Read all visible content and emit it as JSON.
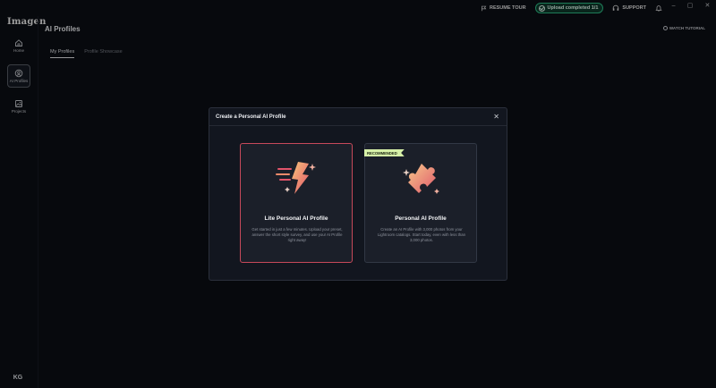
{
  "app": {
    "logo": "Imagen",
    "window_controls": [
      "–",
      "▢",
      "✕"
    ]
  },
  "topbar": {
    "resume_tour": "RESUME TOUR",
    "upload_status": "Upload completed 1/1",
    "support": "SUPPORT",
    "colors": {
      "upload_border": "#2fbf87",
      "upload_bg": "#0f3a2c"
    }
  },
  "sidebar": {
    "items": [
      {
        "label": "Home",
        "icon": "home-icon",
        "active": false
      },
      {
        "label": "AI Profiles",
        "icon": "ai-profiles-icon",
        "active": true
      },
      {
        "label": "Projects",
        "icon": "projects-icon",
        "active": false
      }
    ],
    "avatar_initials": "KG"
  },
  "main": {
    "title": "AI Profiles",
    "watch_tutorial": "WATCH TUTORIAL",
    "tabs": [
      {
        "label": "My Profiles",
        "active": true
      },
      {
        "label": "Profile Showcase",
        "active": false
      }
    ]
  },
  "modal": {
    "title": "Create a Personal AI Profile",
    "close_icon": "close-icon",
    "cards": [
      {
        "title": "Lite Personal AI Profile",
        "description": "Get started in just a few minutes. Upload your preset, answer the short style survey, and use your AI Profile right away!",
        "icon": "lightning-bolt-icon",
        "selected": true,
        "accent": "#c7495a"
      },
      {
        "title": "Personal AI Profile",
        "description": "Create an AI Profile with 3,000 photos from your Lightroom catalogs. Start today, even with less than 3,000 photos.",
        "icon": "puzzle-piece-icon",
        "badge": "RECOMMENDED",
        "selected": false,
        "badge_color": "#d6f0a8"
      }
    ]
  }
}
